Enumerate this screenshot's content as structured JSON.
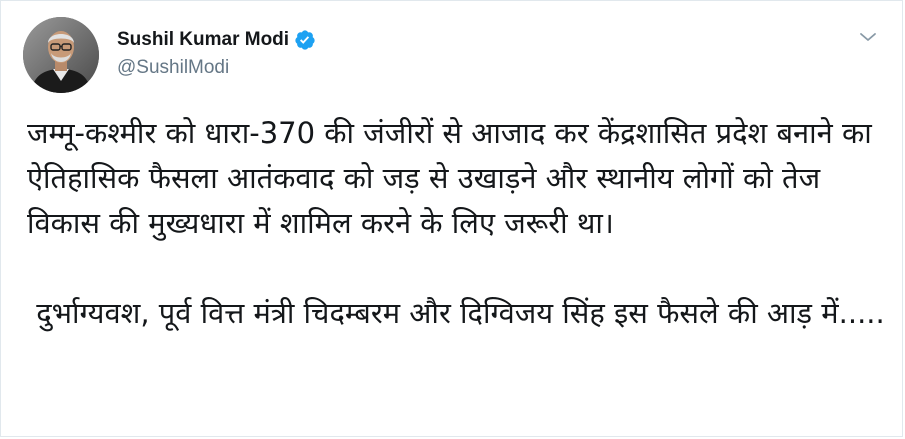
{
  "user": {
    "display_name": "Sushil Kumar Modi",
    "handle": "@SushilModi",
    "verified": true,
    "verified_icon": "verified-badge-icon",
    "verified_color": "#1da1f2"
  },
  "menu": {
    "icon": "chevron-down-icon",
    "color": "#8899a6"
  },
  "tweet": {
    "paragraph_1": "जम्मू-कश्मीर को धारा-370 की जंजीरों से आजाद कर केंद्रशासित प्रदेश बनाने का ऐतिहासिक फैसला आतंकवाद को जड़ से उखाड़ने और स्थानीय लोगों को तेज विकास की मुख्यधारा में शामिल करने के लिए जरूरी था।",
    "paragraph_2": " दुर्भाग्यवश, पूर्व वित्त मंत्री चिदम्बरम और दिग्विजय सिंह इस फैसले की आड़ में....."
  }
}
